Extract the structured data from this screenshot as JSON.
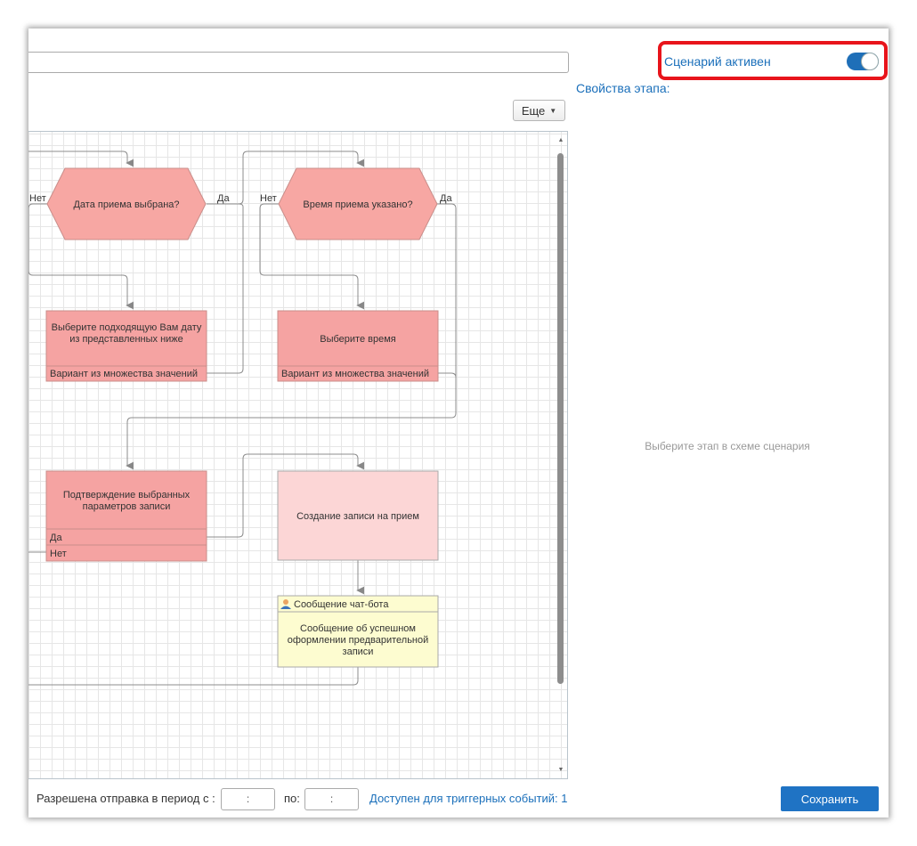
{
  "header": {
    "scenario_name_value": "",
    "active_label": "Сценарий активен",
    "active_state": true
  },
  "toolbar": {
    "more_label": "Еще"
  },
  "diagram": {
    "decisions": [
      {
        "text": "Дата приема выбрана?",
        "no_label": "Нет",
        "yes_label": "Да"
      },
      {
        "text": "Время приема указано?",
        "no_label": "Нет",
        "yes_label": "Да"
      }
    ],
    "choose_date": {
      "lines": [
        "Выберите подходящую Вам дату",
        "из представленных ниже"
      ],
      "variant": "Вариант из множества значений"
    },
    "choose_time": {
      "text": "Выберите время",
      "variant": "Вариант из множества значений"
    },
    "confirm": {
      "lines": [
        "Подтверждение выбранных",
        "параметров записи"
      ],
      "option_yes": "Да",
      "option_no": "Нет"
    },
    "create_record": {
      "text": "Создание записи на прием"
    },
    "bot_message": {
      "header": "Сообщение чат-бота",
      "lines": [
        "Сообщение об успешном",
        "оформлении предварительной",
        "записи"
      ]
    }
  },
  "properties": {
    "title": "Свойства этапа:",
    "hint": "Выберите этап в схеме сценария"
  },
  "footer": {
    "period_label": "Разрешена отправка в период с :",
    "from_value": ":",
    "to_label": "по:",
    "to_value": ":",
    "triggers_link": "Доступен для триггерных событий: 1",
    "save_label": "Сохранить"
  },
  "colors": {
    "accent": "#1f73c4",
    "highlight": "#e8141b",
    "decision_fill": "#f7a7a3",
    "step_fill": "#f5a3a2",
    "create_fill": "#fcd6d6",
    "message_fill": "#fdfcd0"
  }
}
